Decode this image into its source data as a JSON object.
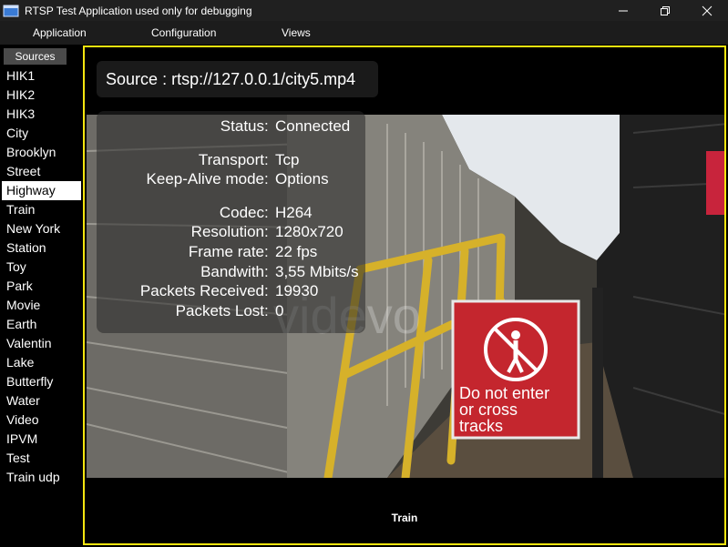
{
  "window": {
    "title": "RTSP Test Application used only for debugging"
  },
  "menu": {
    "items": [
      "Application",
      "Configuration",
      "Views"
    ]
  },
  "sidebar": {
    "header": "Sources",
    "selected": "Highway",
    "items": [
      "HIK1",
      "HIK2",
      "HIK3",
      "City",
      "Brooklyn",
      "Street",
      "Highway",
      "Train",
      "New York",
      "Station",
      "Toy",
      "Park",
      "Movie",
      "Earth",
      "Valentin",
      "Lake",
      "Butterfly",
      "Water",
      "Video",
      "IPVM",
      "Test",
      "Train udp"
    ]
  },
  "viewer": {
    "source_label": "Source",
    "source_url": "rtsp://127.0.0.1/city5.mp4",
    "caption": "Train",
    "sign_lines": [
      "Do not enter",
      "or cross",
      "tracks"
    ],
    "watermark": "videvo",
    "border_color": "#f5e50f"
  },
  "info": [
    {
      "label": "Status",
      "value": "Connected"
    },
    {
      "label": "Transport",
      "value": "Tcp"
    },
    {
      "label": "Keep-Alive mode",
      "value": "Options"
    },
    {
      "label": "Codec",
      "value": "H264"
    },
    {
      "label": "Resolution",
      "value": "1280x720"
    },
    {
      "label": "Frame rate",
      "value": "22 fps"
    },
    {
      "label": "Bandwith",
      "value": "3,55 Mbits/s"
    },
    {
      "label": "Packets Received",
      "value": "19930"
    },
    {
      "label": "Packets Lost",
      "value": "0"
    }
  ],
  "icons": {
    "app": "app-window-icon",
    "minimize": "minimize-icon",
    "maximize": "restore-icon",
    "close": "close-icon"
  }
}
